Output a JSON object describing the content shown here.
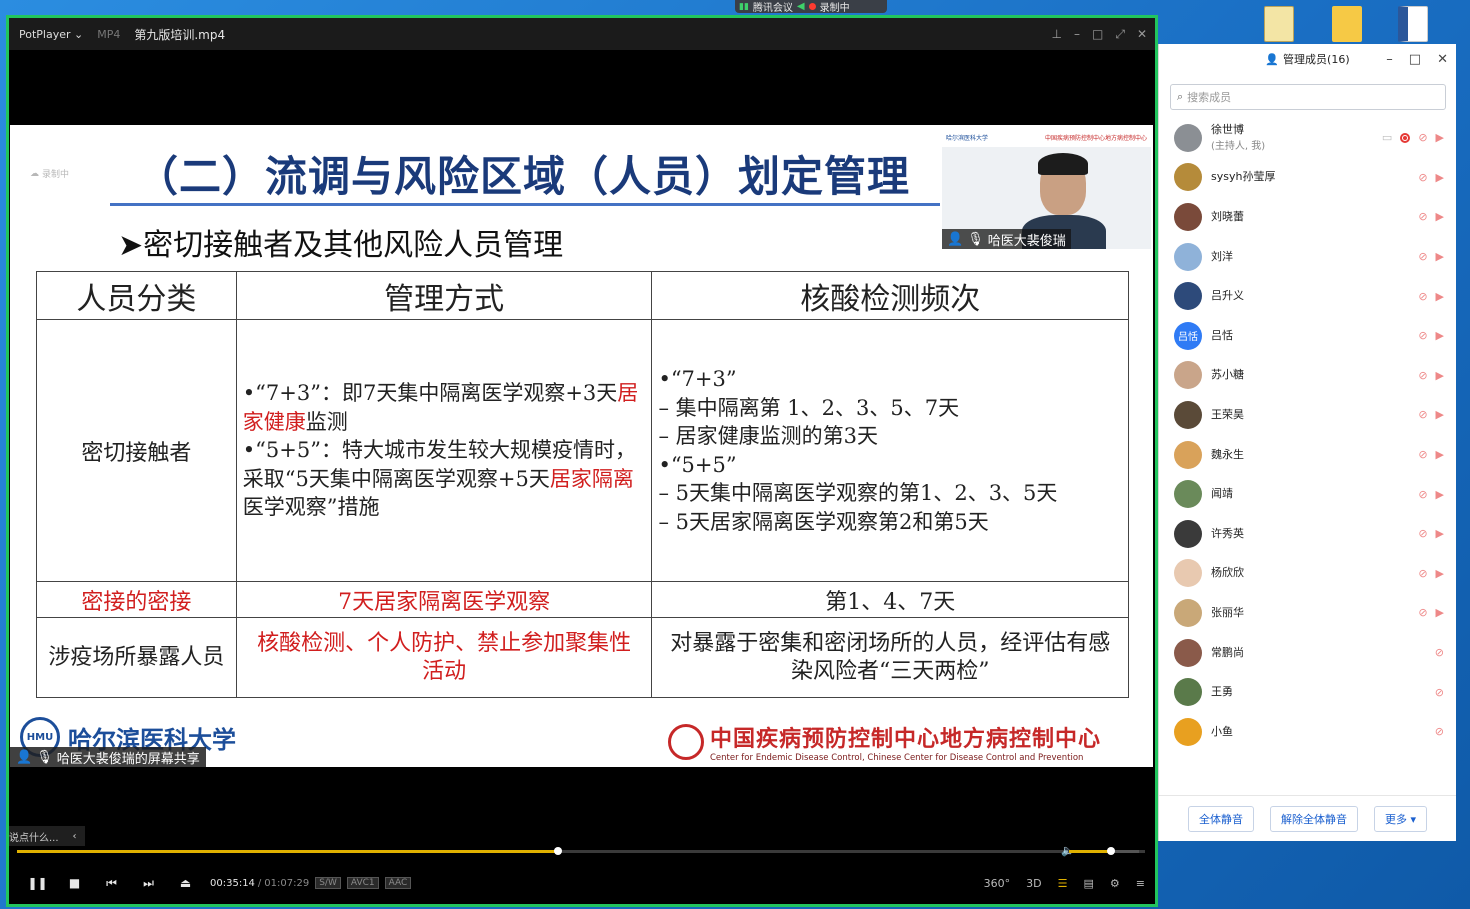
{
  "meeting_bar": {
    "app": "腾讯会议",
    "recording": "录制中"
  },
  "player": {
    "brand": "PotPlayer",
    "format": "MP4",
    "filename": "第九版培训.mp4",
    "current_time": "00:35:14",
    "separator": "/",
    "duration": "01:07:29",
    "progress": 0.48,
    "volume": 0.57,
    "badges": [
      "S/W",
      "AVC1",
      "AAC"
    ],
    "right_controls": [
      "360°",
      "3D"
    ],
    "side_tab": "说点什么..."
  },
  "slide": {
    "recording_tag": "录制中",
    "title": "（二）流调与风险区域（人员）划定管理",
    "subtitle": "➤密切接触者及其他风险人员管理",
    "table": {
      "headers": [
        "人员分类",
        "管理方式",
        "核酸检测频次"
      ],
      "row1": {
        "category": "密切接触者",
        "mgmt_p1": "•“7+3”：即7天集中隔离医学观察+3天",
        "mgmt_p1_red": "居家健康",
        "mgmt_p1_tail": "监测",
        "mgmt_p2": "•“5+5”：特大城市发生较大规模疫情时，采取“5天集中隔离医学观察+5天",
        "mgmt_p2_red": "居家隔离",
        "mgmt_p2_tail": "医学观察”措施",
        "testing": [
          "•“7+3”",
          "– 集中隔离第 1、2、3、5、7天",
          "– 居家健康监测的第3天",
          "•“5+5”",
          "– 5天集中隔离医学观察的第1、2、3、5天",
          "– 5天居家隔离医学观察第2和第5天"
        ]
      },
      "row2": {
        "category": "密接的密接",
        "mgmt": "7天居家隔离医学观察",
        "testing": "第1、4、7天"
      },
      "row3": {
        "category": "涉疫场所暴露人员",
        "mgmt": "核酸检测、个人防护、禁止参加聚集性活动",
        "testing": "对暴露于密集和密闭场所的人员，经评估有感染风险者“三天两检”"
      }
    },
    "footer_left": {
      "logo_text": "HMU",
      "university": "哈尔滨医科大学"
    },
    "share_tag": "哈医大裴俊瑞的屏幕共享",
    "footer_right": {
      "cn": "中国疾病预防控制中心地方病控制中心",
      "en": "Center for Endemic Disease Control, Chinese Center for Disease Control and Prevention"
    },
    "presenter": {
      "name": "哈医大裴俊瑞"
    }
  },
  "panel": {
    "title": "管理成员(16)",
    "search_placeholder": "搜索成员",
    "members": [
      {
        "name": "徐世博",
        "sub": "(主持人, 我)",
        "color": "#8b8f94",
        "initial": ""
      },
      {
        "name": "sysyh孙莹厚",
        "sub": "",
        "color": "#b58b3a",
        "initial": ""
      },
      {
        "name": "刘晓蕾",
        "sub": "",
        "color": "#7a4a3a",
        "initial": ""
      },
      {
        "name": "刘洋",
        "sub": "",
        "color": "#8fb2d9",
        "initial": ""
      },
      {
        "name": "吕升义",
        "sub": "",
        "color": "#2d4a7a",
        "initial": ""
      },
      {
        "name": "吕恬",
        "sub": "",
        "color": "#2f7bf5",
        "initial": "吕恬"
      },
      {
        "name": "苏小糖",
        "sub": "",
        "color": "#c9a58a",
        "initial": ""
      },
      {
        "name": "王荣昊",
        "sub": "",
        "color": "#5a4a38",
        "initial": ""
      },
      {
        "name": "魏永生",
        "sub": "",
        "color": "#d9a25a",
        "initial": ""
      },
      {
        "name": "闻靖",
        "sub": "",
        "color": "#6a8a5a",
        "initial": ""
      },
      {
        "name": "许秀英",
        "sub": "",
        "color": "#3a3a3a",
        "initial": ""
      },
      {
        "name": "杨欣欣",
        "sub": "",
        "color": "#e8c9b0",
        "initial": ""
      },
      {
        "name": "张丽华",
        "sub": "",
        "color": "#c9a878",
        "initial": ""
      },
      {
        "name": "常鹏尚",
        "sub": "",
        "color": "#8a5a4a",
        "initial": ""
      },
      {
        "name": "王勇",
        "sub": "",
        "color": "#5a7a4a",
        "initial": ""
      },
      {
        "name": "小鱼",
        "sub": "",
        "color": "#e8a020",
        "initial": ""
      }
    ],
    "buttons": [
      "全体静音",
      "解除全体静音",
      "更多 ▾"
    ]
  },
  "colors": {
    "accent_green": "#22c55e",
    "seek_yellow": "#e0b100",
    "title_blue": "#1a3a7a",
    "cdc_red": "#c62828"
  }
}
